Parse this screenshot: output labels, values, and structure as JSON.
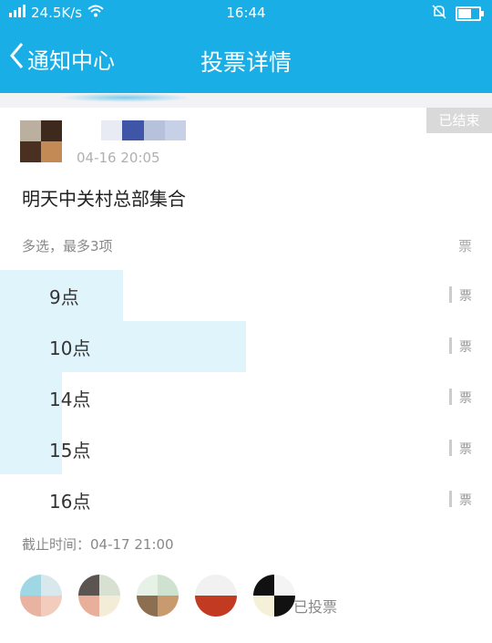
{
  "status_bar": {
    "network_speed": "24.5K/s",
    "time": "16:44"
  },
  "nav": {
    "back_label": "通知中心",
    "title": "投票详情"
  },
  "poll": {
    "status_badge": "已结束",
    "timestamp": "04-16 20:05",
    "title": "明天中关村总部集合",
    "hint": "多选，最多3项",
    "hint_count": "票",
    "options": [
      {
        "label": "9点",
        "count": "票",
        "fraction": 0.25
      },
      {
        "label": "10点",
        "count": "票",
        "fraction": 0.5
      },
      {
        "label": "14点",
        "count": "票",
        "fraction": 0.125
      },
      {
        "label": "15点",
        "count": "票",
        "fraction": 0.125
      },
      {
        "label": "16点",
        "count": "票",
        "fraction": 0
      }
    ],
    "deadline": "截止时间：04-17 21:00",
    "voted_label": "已投票"
  },
  "colors": {
    "brand": "#19aee6",
    "bar_fill": "#dff4fb",
    "badge_bg": "#d9d9d9"
  }
}
